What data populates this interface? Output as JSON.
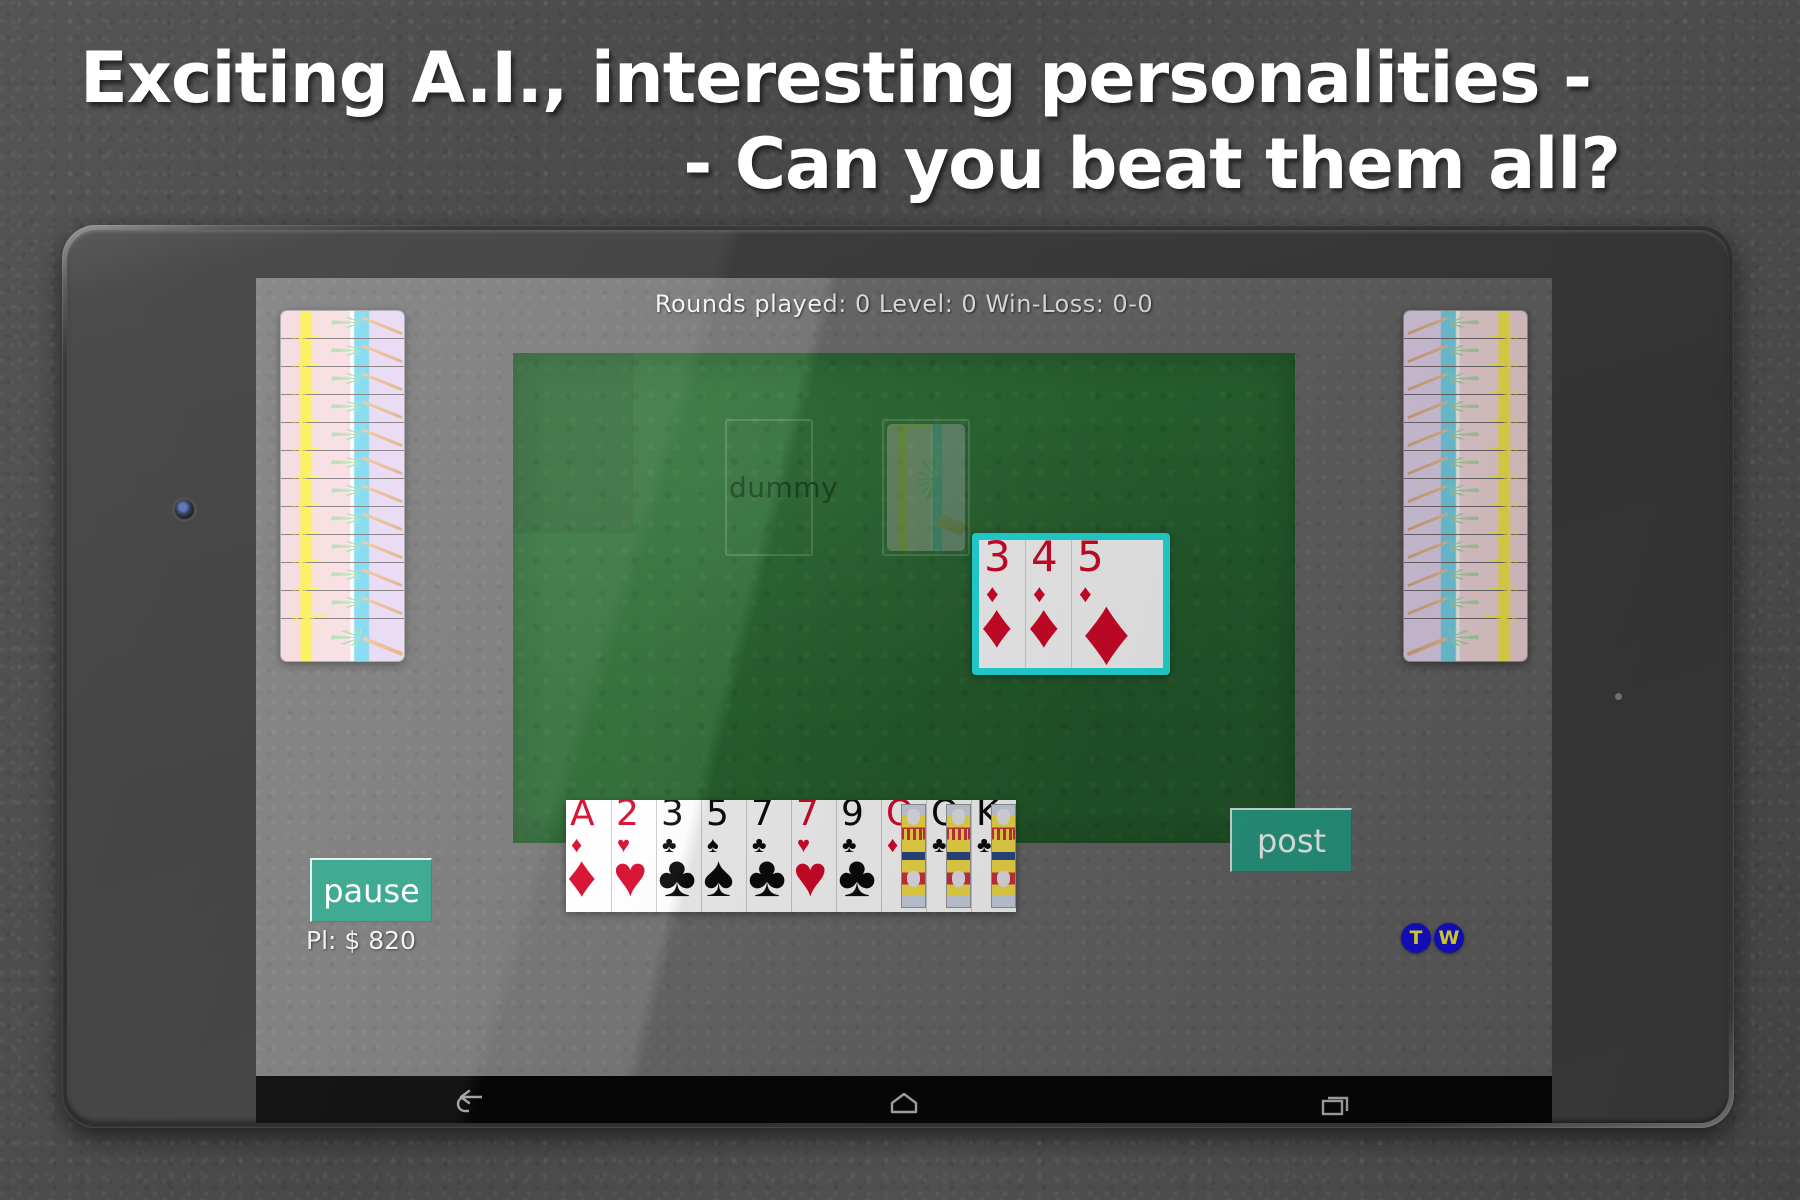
{
  "promo": {
    "headline_line1": "Exciting A.I.,  interesting personalities -",
    "headline_line2": "- Can you beat them all?"
  },
  "device": {
    "type": "android-tablet",
    "camera_icon": "front-camera-lens",
    "nav": {
      "back_label": "Back",
      "home_label": "Home",
      "recents_label": "Recent apps"
    }
  },
  "game": {
    "status": {
      "text": "Rounds played: 0  Level: 0  Win-Loss: 0-0",
      "rounds_played": "0",
      "level": "0",
      "win_loss": "0-0"
    },
    "table": {
      "dummy_slot_label": "dummy",
      "deck_slot_label": ""
    },
    "played_cards": [
      {
        "rank": "3",
        "suit": "diamond",
        "glyph": "♦",
        "color": "#d8092a"
      },
      {
        "rank": "4",
        "suit": "diamond",
        "glyph": "♦",
        "color": "#d8092a"
      },
      {
        "rank": "5",
        "suit": "diamond",
        "glyph": "♦",
        "color": "#d8092a"
      }
    ],
    "selection_color": "#25e3e3",
    "buttons": {
      "back": "back",
      "post": "post",
      "pause": "pause",
      "color": "#2aa086"
    },
    "hand": [
      {
        "rank": "A",
        "suit": "diamond",
        "glyph": "♦",
        "color": "red",
        "court": false
      },
      {
        "rank": "2",
        "suit": "heart",
        "glyph": "♥",
        "color": "red",
        "court": false
      },
      {
        "rank": "3",
        "suit": "club",
        "glyph": "♣",
        "color": "black",
        "court": false
      },
      {
        "rank": "5",
        "suit": "spade",
        "glyph": "♠",
        "color": "black",
        "court": false
      },
      {
        "rank": "7",
        "suit": "club",
        "glyph": "♣",
        "color": "black",
        "court": false
      },
      {
        "rank": "7",
        "suit": "heart",
        "glyph": "♥",
        "color": "red",
        "court": false
      },
      {
        "rank": "9",
        "suit": "club",
        "glyph": "♣",
        "color": "black",
        "court": false
      },
      {
        "rank": "Q",
        "suit": "diamond",
        "glyph": "♦",
        "color": "red",
        "court": true
      },
      {
        "rank": "Q",
        "suit": "club",
        "glyph": "♣",
        "color": "black",
        "court": true
      },
      {
        "rank": "K",
        "suit": "club",
        "glyph": "♣",
        "color": "black",
        "court": true
      }
    ],
    "money": "Pl: $ 820",
    "opponents": {
      "left_card_count": 12,
      "right_card_count": 12,
      "card_back_theme": "tropical-beach-palm-sunset"
    },
    "badges": [
      {
        "letter": "T",
        "bg": "#1510d8",
        "fg": "#f5f035"
      },
      {
        "letter": "W",
        "bg": "#1510d8",
        "fg": "#f5f035"
      }
    ]
  }
}
